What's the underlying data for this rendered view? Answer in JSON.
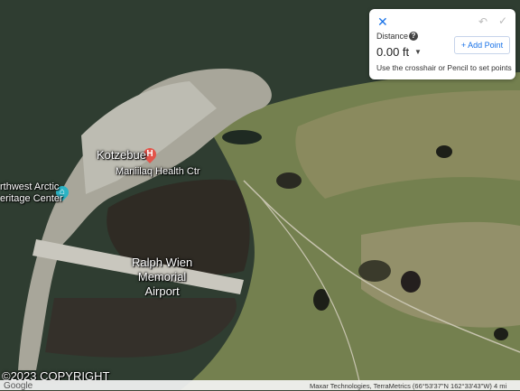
{
  "map": {
    "places": {
      "town": "Kotzebue",
      "hospital": "Maniilaq Health Ctr",
      "center_line1": "rthwest Arctic",
      "center_line2": "eritage Center",
      "airport_line1": "Ralph Wien",
      "airport_line2": "Memorial",
      "airport_line3": "Airport"
    },
    "pins": {
      "hospital_glyph": "H",
      "center_glyph": "⌂"
    },
    "icons": {
      "hospital": "hospital-pin-icon",
      "heritage": "museum-pin-icon"
    },
    "copyright": "©2023 COPYRIGHT",
    "colors": {
      "water": "#2c3a2f",
      "tundra": "#6f7a4c",
      "lagoon": "#2e2a22",
      "pin_red": "#e3544a",
      "pin_teal": "#2bb3c4"
    }
  },
  "measure_panel": {
    "close_icon": "close-icon",
    "undo_icon": "undo-icon",
    "check_icon": "check-icon",
    "distance_label": "Distance",
    "distance_value": "0.00 ft",
    "add_point": "+ Add Point",
    "hint": "Use the crosshair or Pencil to set points",
    "accent": "#1a73e8"
  },
  "footer": {
    "logo": "Google",
    "attribution": "Maxar Technologies, TerraMetrics   (66°53'37\"N 162°33'43\"W) 4 mi"
  }
}
